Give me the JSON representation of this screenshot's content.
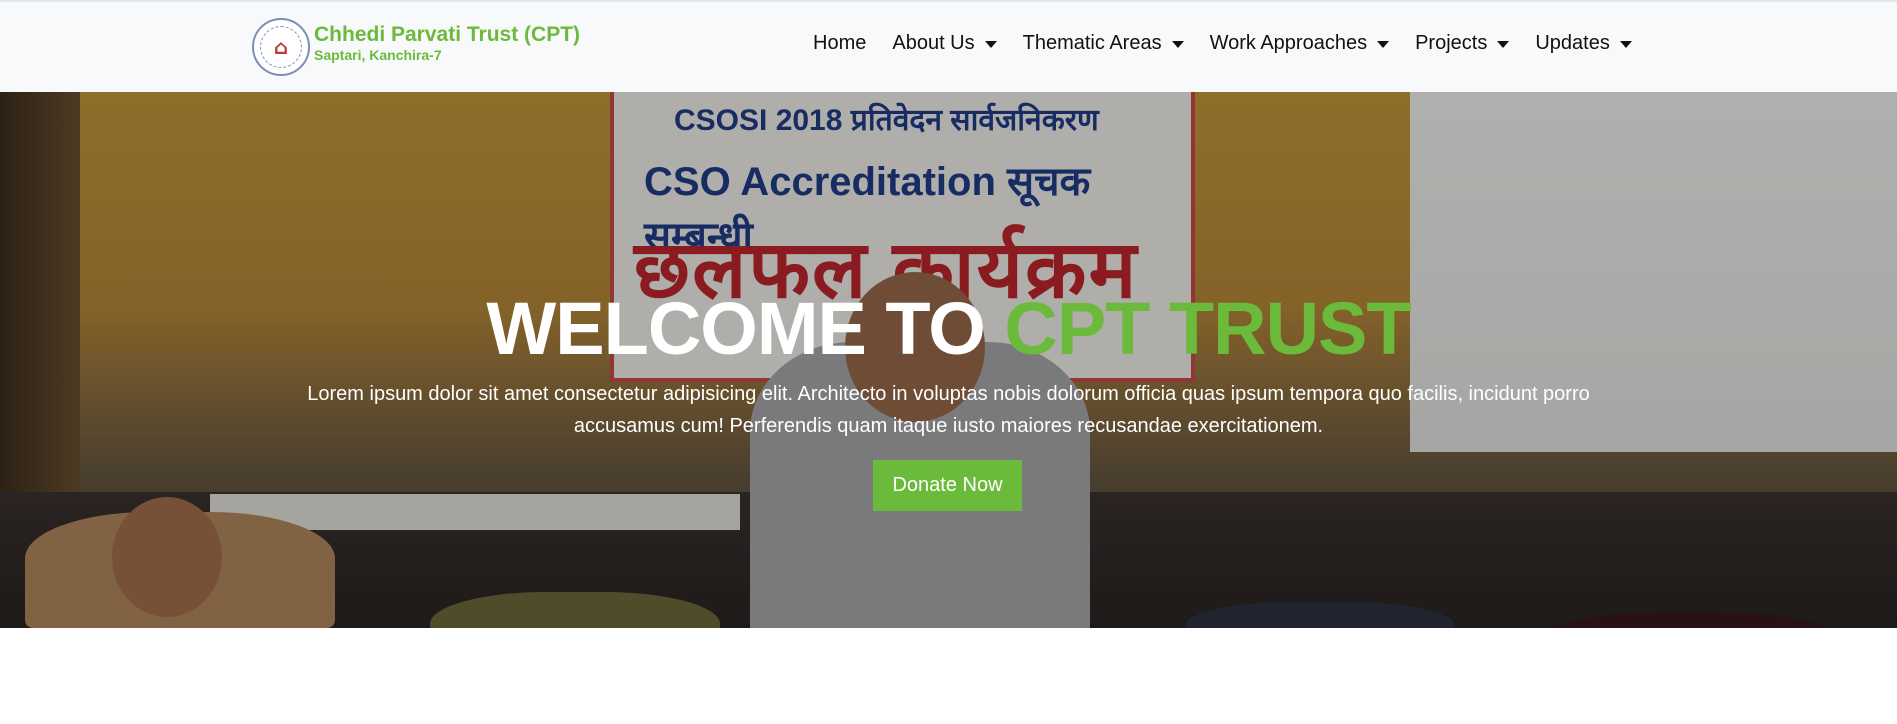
{
  "brand": {
    "name": "Chhedi Parvati Trust (CPT)",
    "location": "Saptari, Kanchira-7",
    "logo_icon": "trust-seal-logo",
    "accent_color": "#6cba3c"
  },
  "nav": {
    "items": [
      {
        "label": "Home",
        "dropdown": false
      },
      {
        "label": "About Us",
        "dropdown": true
      },
      {
        "label": "Thematic Areas",
        "dropdown": true
      },
      {
        "label": "Work Approaches",
        "dropdown": true
      },
      {
        "label": "Projects",
        "dropdown": true
      },
      {
        "label": "Updates",
        "dropdown": true
      }
    ]
  },
  "hero": {
    "title_main": "WELCOME TO ",
    "title_accent": "CPT TRUST",
    "text": "Lorem ipsum dolor sit amet consectetur adipisicing elit. Architecto in voluptas nobis dolorum officia quas ipsum tempora quo facilis, incidunt porro accusamus cum! Perferendis quam itaque iusto maiores recusandae exercitationem.",
    "button_label": "Donate Now",
    "photo": {
      "banner_line1": "CSOSI 2018 प्रतिवेदन सार्वजनिकरण",
      "banner_line2": "CSO Accreditation सूचक सम्बन्धी",
      "banner_line3": "छलफल कार्यक्रम"
    }
  }
}
